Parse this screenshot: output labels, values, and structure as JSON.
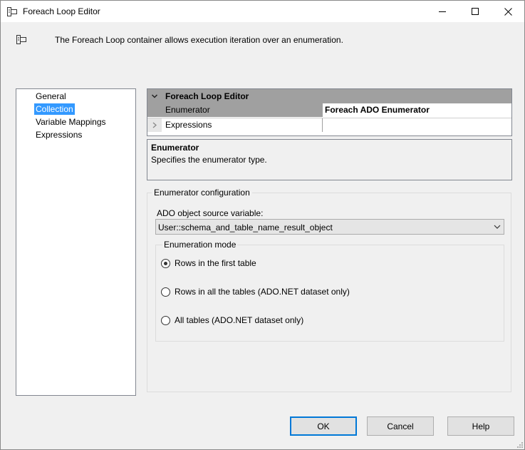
{
  "window": {
    "title": "Foreach Loop Editor",
    "icon": "foreach-loop-icon"
  },
  "header": {
    "description": "The Foreach Loop container allows execution iteration over an enumeration."
  },
  "nav": {
    "items": [
      {
        "label": "General",
        "selected": false
      },
      {
        "label": "Collection",
        "selected": true
      },
      {
        "label": "Variable Mappings",
        "selected": false
      },
      {
        "label": "Expressions",
        "selected": false
      }
    ]
  },
  "property_grid": {
    "category": "Foreach Loop Editor",
    "rows": [
      {
        "name": "Enumerator",
        "value": "Foreach ADO Enumerator"
      },
      {
        "name": "Expressions",
        "value": ""
      }
    ]
  },
  "description_panel": {
    "title": "Enumerator",
    "text": "Specifies the enumerator type."
  },
  "enumerator_config": {
    "group_title": "Enumerator configuration",
    "source_label": "ADO object source variable:",
    "source_value": "User::schema_and_table_name_result_object",
    "mode_title": "Enumeration mode",
    "modes": [
      {
        "label": "Rows in the first table",
        "checked": true
      },
      {
        "label": "Rows in all the tables (ADO.NET dataset only)",
        "checked": false
      },
      {
        "label": "All tables (ADO.NET dataset only)",
        "checked": false
      }
    ]
  },
  "buttons": {
    "ok": "OK",
    "cancel": "Cancel",
    "help": "Help"
  },
  "colors": {
    "selection": "#3399ff",
    "default_button_border": "#0078d7",
    "grid_category": "#a0a0a0"
  }
}
